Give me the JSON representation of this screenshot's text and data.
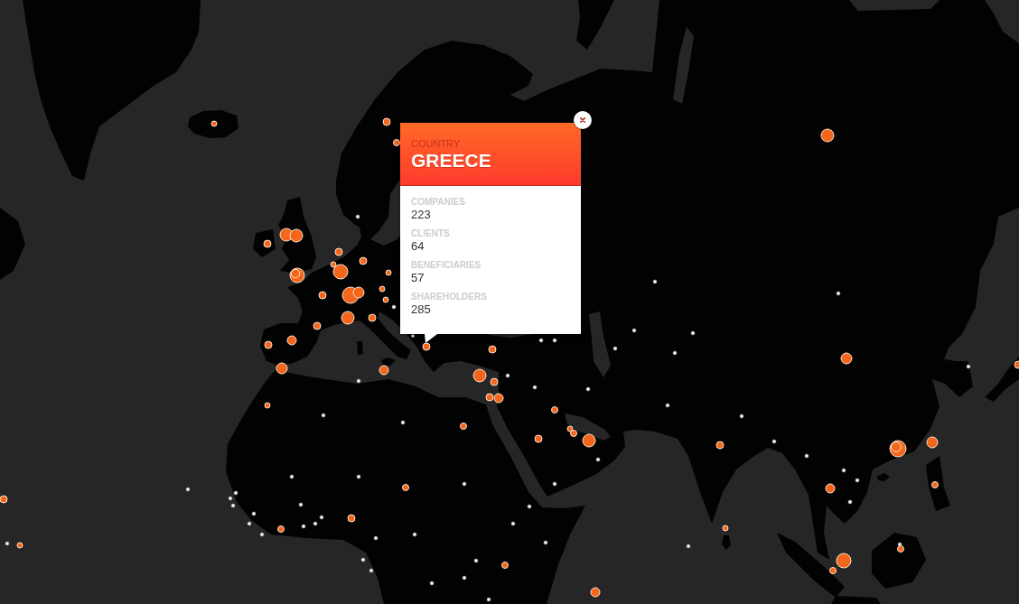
{
  "popup": {
    "label": "COUNTRY",
    "title": "GREECE",
    "fields": [
      {
        "label": "COMPANIES",
        "value": "223"
      },
      {
        "label": "CLIENTS",
        "value": "64"
      },
      {
        "label": "BENEFICIARIES",
        "value": "57"
      },
      {
        "label": "SHAREHOLDERS",
        "value": "285"
      }
    ]
  }
}
